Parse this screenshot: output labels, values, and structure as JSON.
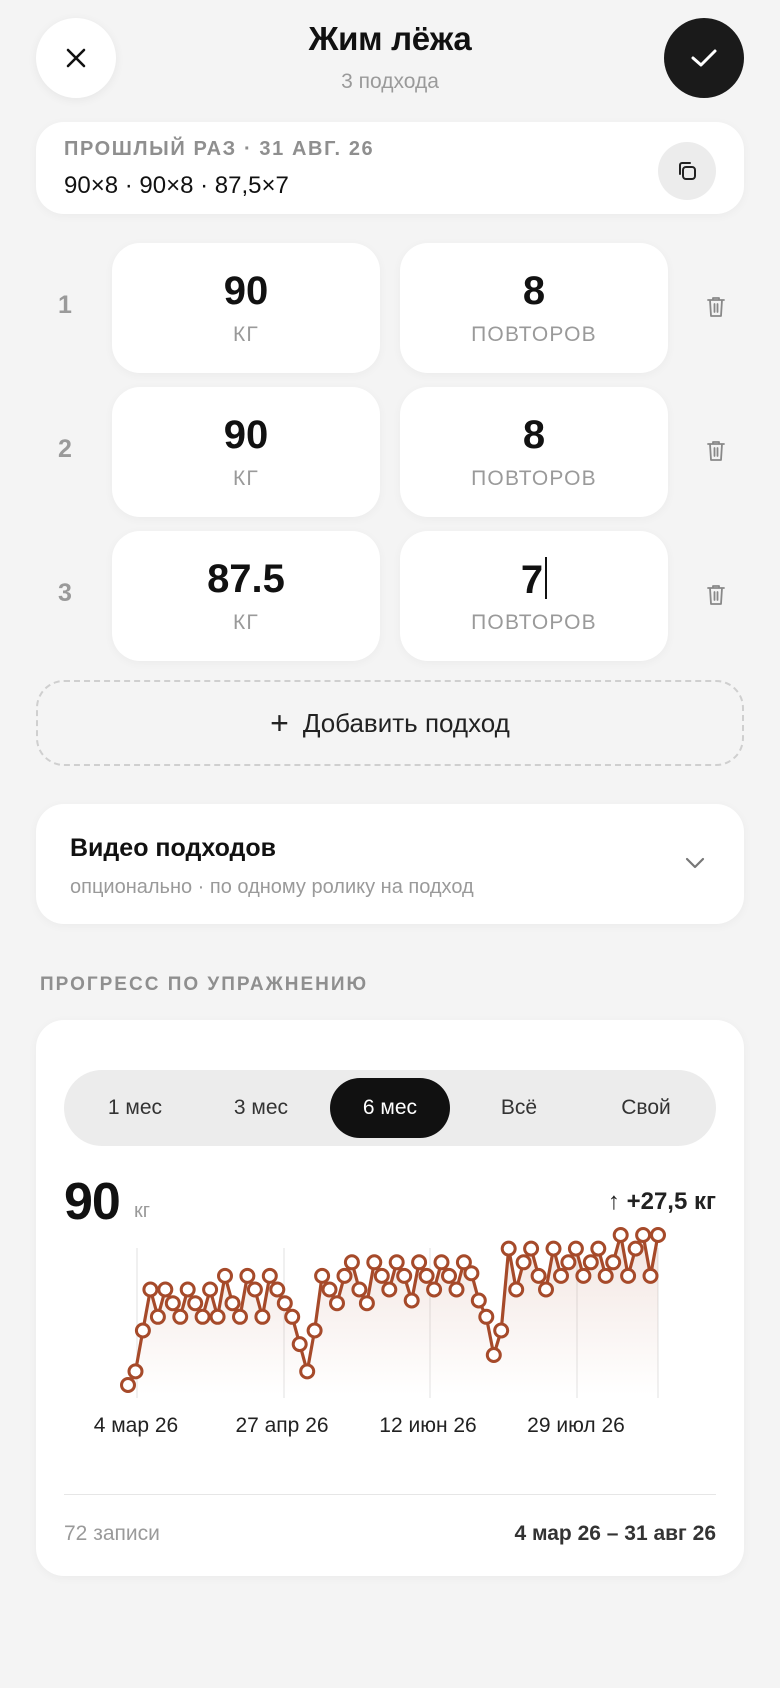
{
  "header": {
    "title": "Жим лёжа",
    "subtitle": "3 подхода",
    "close_icon": "close-icon",
    "done_icon": "check-icon"
  },
  "last_time": {
    "label": "ПРОШЛЫЙ РАЗ · 31 АВГ. 26",
    "value": "90×8 · 90×8 · 87,5×7",
    "copy_icon": "copy-icon"
  },
  "sets": [
    {
      "number": "1",
      "weight": "90",
      "weight_unit": "КГ",
      "reps": "8",
      "reps_unit": "ПОВТОРОВ"
    },
    {
      "number": "2",
      "weight": "90",
      "weight_unit": "КГ",
      "reps": "8",
      "reps_unit": "ПОВТОРОВ"
    },
    {
      "number": "3",
      "weight": "87.5",
      "weight_unit": "КГ",
      "reps": "7",
      "reps_unit": "ПОВТОРОВ"
    }
  ],
  "add_set": {
    "label": "Добавить подход"
  },
  "video": {
    "title": "Видео подходов",
    "subtitle": "опционально · по одному ролику на подход"
  },
  "progress": {
    "section_label": "ПРОГРЕСС ПО УПРАЖНЕНИЮ",
    "ranges": [
      {
        "label": "1 мес",
        "active": false
      },
      {
        "label": "3 мес",
        "active": false
      },
      {
        "label": "6 мес",
        "active": true
      },
      {
        "label": "Всё",
        "active": false
      },
      {
        "label": "Свой",
        "active": false
      }
    ],
    "current_value": "90",
    "current_unit": "кг",
    "delta": "↑ +27,5 кг",
    "footer_count": "72 записи",
    "footer_range": "4 мар 26 – 31 авг 26"
  },
  "chart_data": {
    "type": "line",
    "x_tick_labels": [
      "4 мар 26",
      "27 апр 26",
      "12 июн 26",
      "29 июл 26"
    ],
    "ylim": [
      62.5,
      90
    ],
    "unit": "кг",
    "line_color": "#a64a2a",
    "values": [
      62.5,
      65,
      72.5,
      80,
      75,
      80,
      77.5,
      75,
      80,
      77.5,
      75,
      80,
      75,
      82.5,
      77.5,
      75,
      82.5,
      80,
      75,
      82.5,
      80,
      77.5,
      75,
      70,
      65,
      72.5,
      82.5,
      80,
      77.5,
      82.5,
      85,
      80,
      77.5,
      85,
      82.5,
      80,
      85,
      82.5,
      78,
      85,
      82.5,
      80,
      85,
      82.5,
      80,
      85,
      83,
      78,
      75,
      68,
      72.5,
      87.5,
      80,
      85,
      87.5,
      82.5,
      80,
      87.5,
      82.5,
      85,
      87.5,
      82.5,
      85,
      87.5,
      82.5,
      85,
      90,
      82.5,
      87.5,
      90,
      82.5,
      90
    ]
  }
}
